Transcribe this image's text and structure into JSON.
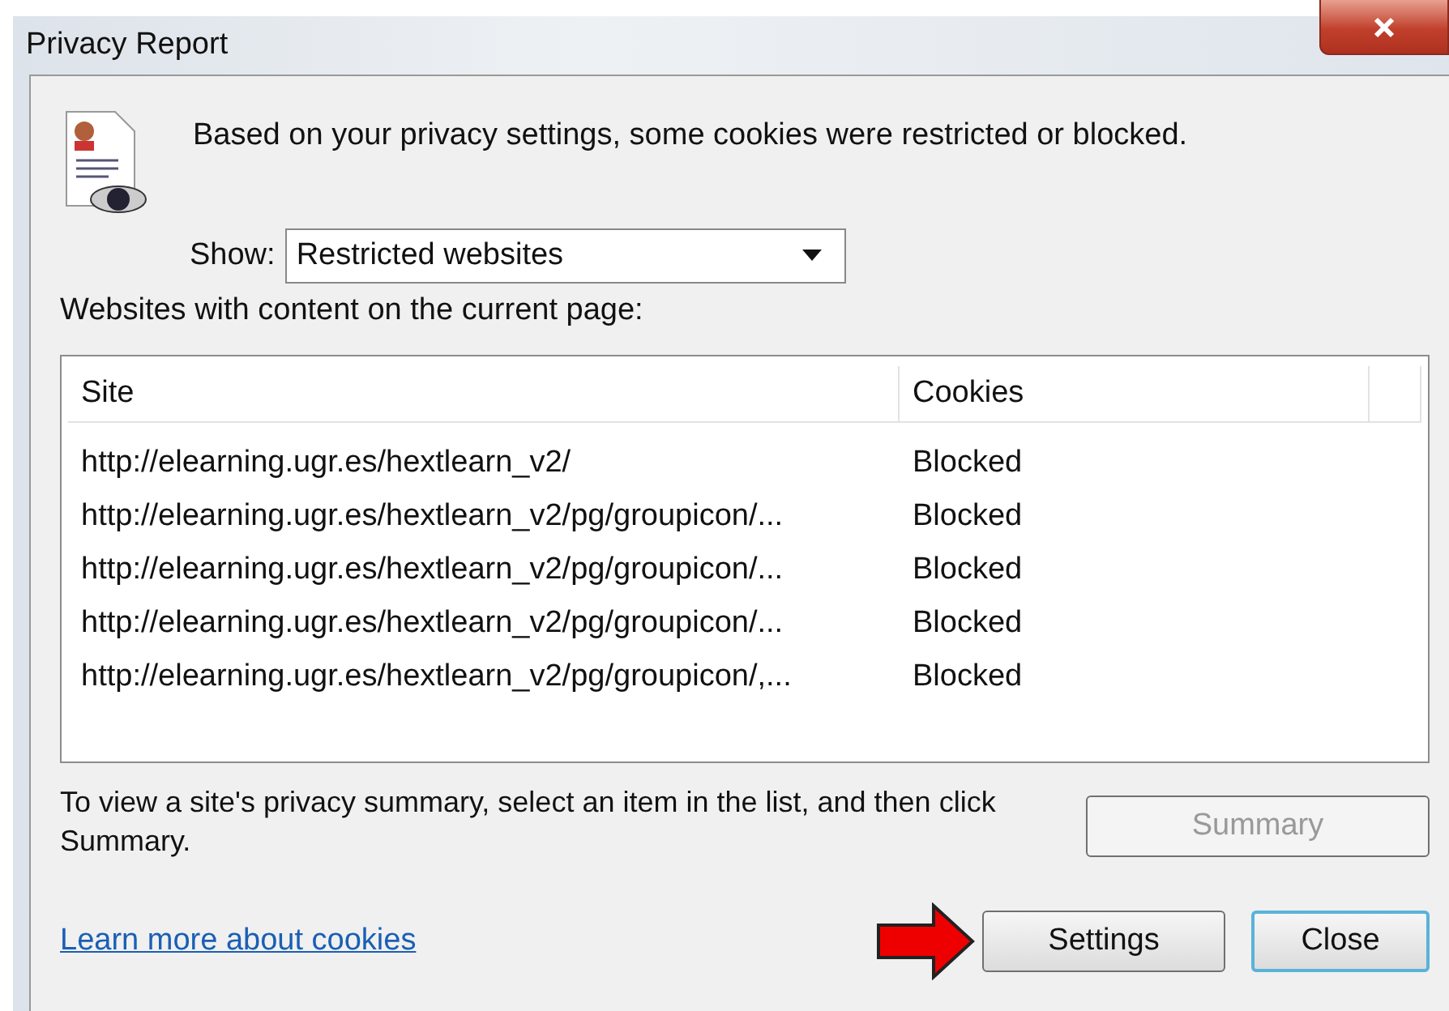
{
  "window": {
    "title": "Privacy Report"
  },
  "message": "Based on your privacy settings, some cookies were restricted or blocked.",
  "show": {
    "label": "Show:",
    "value": "Restricted websites"
  },
  "list_label": "Websites with content on the current page:",
  "table": {
    "columns": [
      "Site",
      "Cookies"
    ],
    "rows": [
      {
        "site": "http://elearning.ugr.es/hextlearn_v2/",
        "cookies": "Blocked",
        "selected": false
      },
      {
        "site": "http://elearning.ugr.es/hextlearn_v2/pg/groupicon/...",
        "cookies": "Blocked",
        "selected": false
      },
      {
        "site": "http://elearning.ugr.es/hextlearn_v2/pg/groupicon/...",
        "cookies": "Blocked",
        "selected": false
      },
      {
        "site": "http://elearning.ugr.es/hextlearn_v2/pg/groupicon/...",
        "cookies": "Blocked",
        "selected": false
      },
      {
        "site": "http://elearning.ugr.es/hextlearn_v2/pg/groupicon/,...",
        "cookies": "Blocked",
        "selected": false
      }
    ]
  },
  "hint": "To view a site's privacy summary, select an item in the list, and then click Summary.",
  "summary_button": {
    "label": "Summary",
    "disabled": true
  },
  "link": "Learn more about cookies",
  "buttons": [
    {
      "label": "Settings",
      "focused": false
    },
    {
      "label": "Close",
      "focused": true
    }
  ]
}
